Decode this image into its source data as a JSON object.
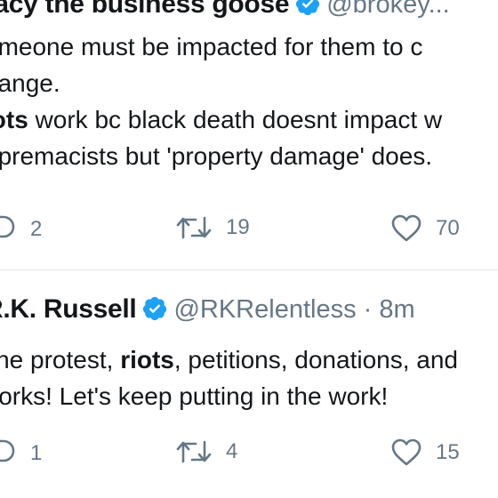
{
  "tweets": [
    {
      "display_name": "racy the business goose",
      "handle": "@brokey...",
      "time": "",
      "text": {
        "line1": "omeone must be impacted for them to c",
        "line2": "hange.",
        "line3_bold": "iots",
        "line3_rest": " work bc black death doesnt impact w",
        "line4": "upremacists but 'property damage' does."
      },
      "actions": {
        "replies": "2",
        "retweets": "19",
        "likes": "70"
      }
    },
    {
      "display_name": "R.K. Russell",
      "handle": "@RKRelentless · 8m",
      "text": {
        "line1_pre": "The protest, ",
        "line1_bold": "riots",
        "line1_post": ", petitions, donations, and",
        "line2": "works! Let's keep putting in the work!"
      },
      "actions": {
        "replies": "1",
        "retweets": "4",
        "likes": "15"
      }
    }
  ],
  "colors": {
    "verified": "#1da1f2",
    "secondary": "#657786",
    "text": "#14171a"
  },
  "icons": [
    "verified-badge-icon",
    "reply-icon",
    "retweet-icon",
    "like-icon"
  ]
}
